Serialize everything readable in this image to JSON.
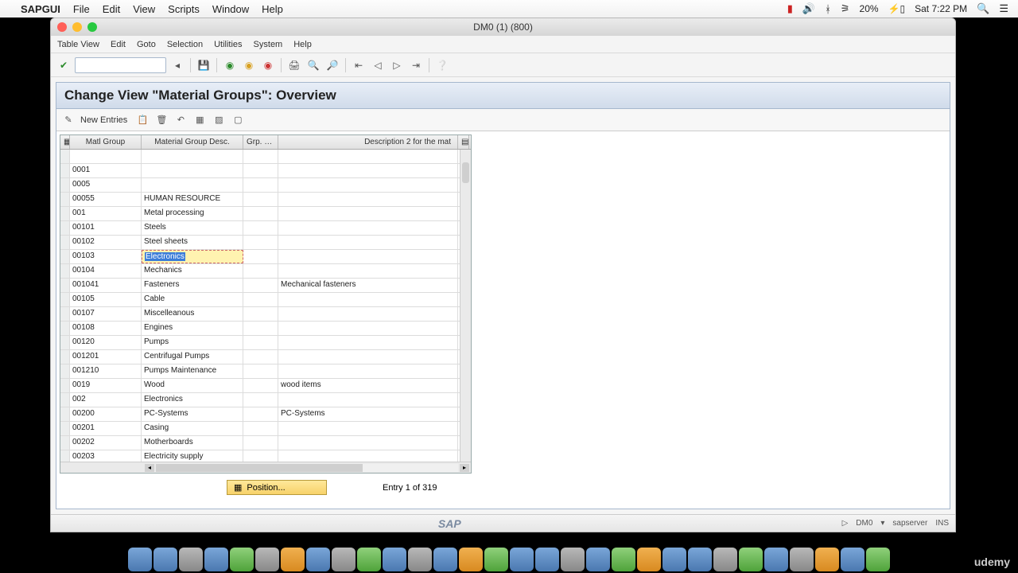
{
  "mac": {
    "app": "SAPGUI",
    "menu": [
      "File",
      "Edit",
      "View",
      "Scripts",
      "Window",
      "Help"
    ],
    "battery": "20%",
    "clock": "Sat 7:22 PM"
  },
  "window": {
    "title": "DM0 (1) (800)"
  },
  "sap_menu": [
    "Table View",
    "Edit",
    "Goto",
    "Selection",
    "Utilities",
    "System",
    "Help"
  ],
  "panel": {
    "title": "Change View \"Material Groups\": Overview",
    "new_entries": "New Entries"
  },
  "columns": {
    "sel": "",
    "c1": "Matl Group",
    "c2": "Material Group Desc.",
    "c3": "Grp. D...",
    "c4": "Description 2 for the mat"
  },
  "rows": [
    {
      "c1": "",
      "c2": "",
      "c3": "",
      "c4": ""
    },
    {
      "c1": "0001",
      "c2": "",
      "c3": "",
      "c4": ""
    },
    {
      "c1": "0005",
      "c2": "",
      "c3": "",
      "c4": ""
    },
    {
      "c1": "00055",
      "c2": "HUMAN RESOURCE",
      "c3": "",
      "c4": ""
    },
    {
      "c1": "001",
      "c2": "Metal processing",
      "c3": "",
      "c4": ""
    },
    {
      "c1": "00101",
      "c2": "Steels",
      "c3": "",
      "c4": ""
    },
    {
      "c1": "00102",
      "c2": "Steel sheets",
      "c3": "",
      "c4": ""
    },
    {
      "c1": "00103",
      "c2": "Electronics",
      "c3": "",
      "c4": "",
      "editing": true
    },
    {
      "c1": "00104",
      "c2": "Mechanics",
      "c3": "",
      "c4": ""
    },
    {
      "c1": "001041",
      "c2": "Fasteners",
      "c3": "",
      "c4": "Mechanical fasteners"
    },
    {
      "c1": "00105",
      "c2": "Cable",
      "c3": "",
      "c4": ""
    },
    {
      "c1": "00107",
      "c2": "Miscelleanous",
      "c3": "",
      "c4": ""
    },
    {
      "c1": "00108",
      "c2": "Engines",
      "c3": "",
      "c4": ""
    },
    {
      "c1": "00120",
      "c2": "Pumps",
      "c3": "",
      "c4": ""
    },
    {
      "c1": "001201",
      "c2": "Centrifugal Pumps",
      "c3": "",
      "c4": ""
    },
    {
      "c1": "001210",
      "c2": "Pumps Maintenance",
      "c3": "",
      "c4": ""
    },
    {
      "c1": "0019",
      "c2": "Wood",
      "c3": "",
      "c4": "wood items"
    },
    {
      "c1": "002",
      "c2": "Electronics",
      "c3": "",
      "c4": ""
    },
    {
      "c1": "00200",
      "c2": "PC-Systems",
      "c3": "",
      "c4": "PC-Systems"
    },
    {
      "c1": "00201",
      "c2": "Casing",
      "c3": "",
      "c4": ""
    },
    {
      "c1": "00202",
      "c2": "Motherboards",
      "c3": "",
      "c4": ""
    },
    {
      "c1": "00203",
      "c2": "Electricity supply",
      "c3": "",
      "c4": ""
    }
  ],
  "position_btn": "Position...",
  "entry_status": "Entry 1 of 319",
  "status": {
    "sap": "SAP",
    "sys": "DM0",
    "server": "sapserver",
    "mode": "INS"
  },
  "udemy": "udemy"
}
